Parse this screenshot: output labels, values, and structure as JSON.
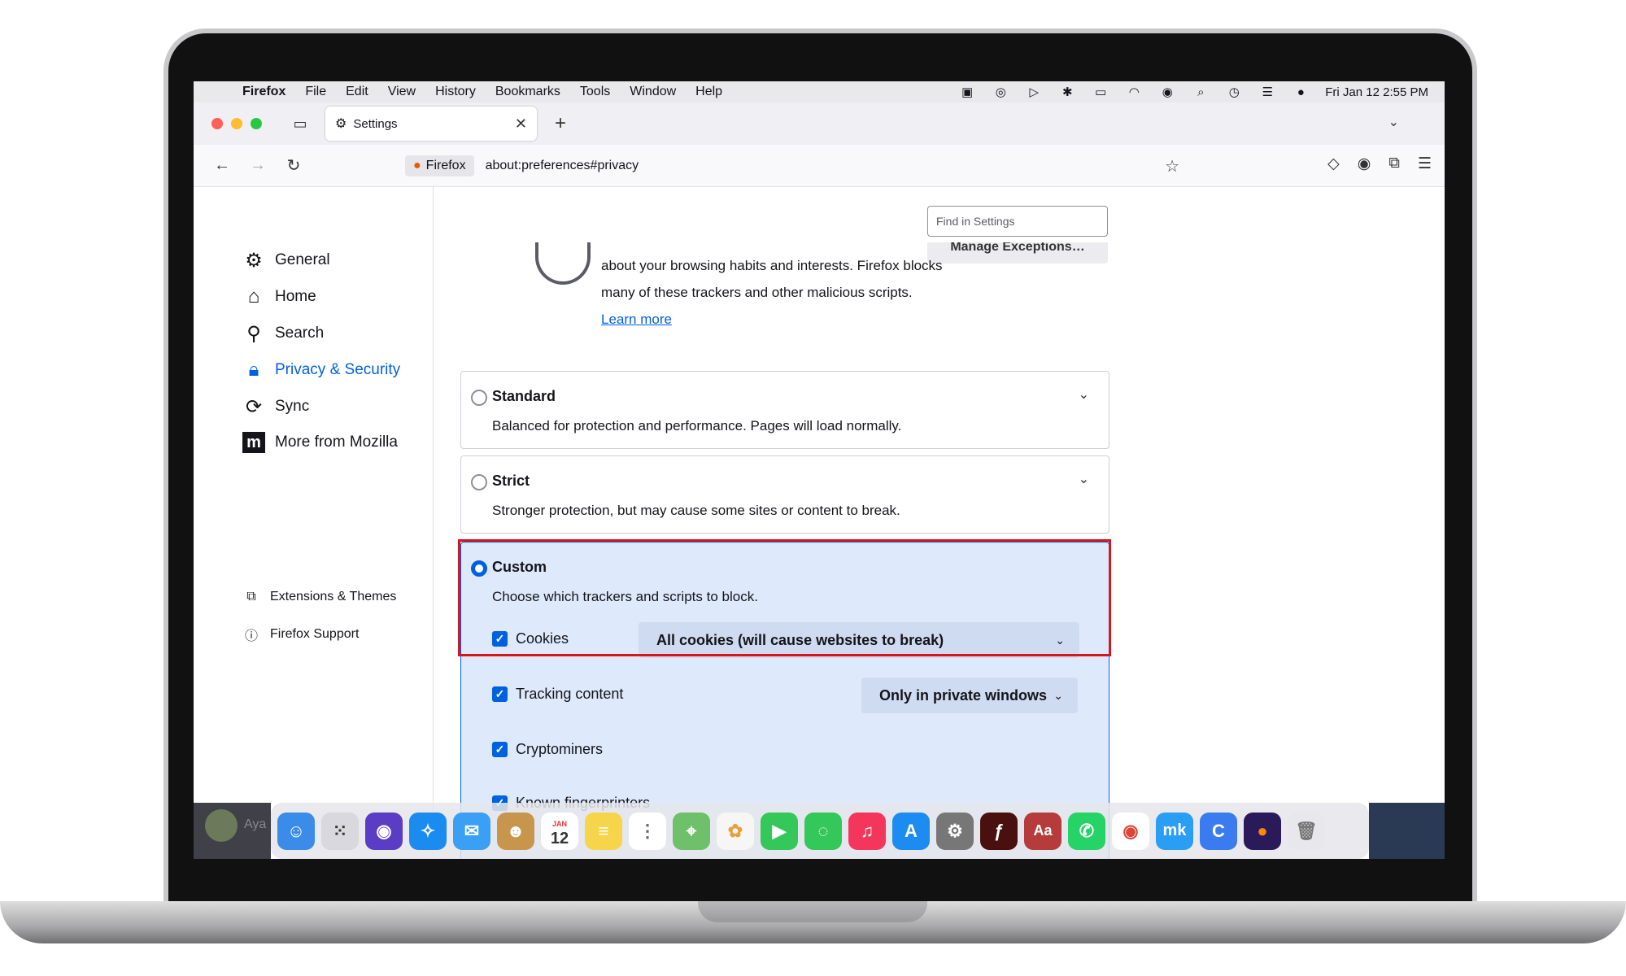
{
  "menubar": {
    "app": "Firefox",
    "items": [
      "File",
      "Edit",
      "View",
      "History",
      "Bookmarks",
      "Tools",
      "Window",
      "Help"
    ],
    "clock": "Fri Jan 12  2:55 PM"
  },
  "tabs": [
    {
      "label": "Settings",
      "active": true
    }
  ],
  "navbar": {
    "identity": "Firefox",
    "url": "about:preferences#privacy"
  },
  "sidebar": {
    "categories": [
      {
        "label": "General",
        "icon": "gear-icon"
      },
      {
        "label": "Home",
        "icon": "home-icon"
      },
      {
        "label": "Search",
        "icon": "search-icon"
      },
      {
        "label": "Privacy & Security",
        "icon": "lock-icon",
        "selected": true
      },
      {
        "label": "Sync",
        "icon": "sync-icon"
      },
      {
        "label": "More from Mozilla",
        "icon": "mozilla-icon"
      }
    ],
    "footer": [
      {
        "label": "Extensions & Themes",
        "icon": "puzzle-icon"
      },
      {
        "label": "Firefox Support",
        "icon": "help-icon"
      }
    ]
  },
  "main": {
    "search_placeholder": "Find in Settings",
    "manage_exceptions": "Manage Exceptions…",
    "intro_line1": "about your browsing habits and interests. Firefox blocks",
    "intro_line2": "many of these trackers and other malicious scripts.",
    "learn_more": "Learn more",
    "options": {
      "standard": {
        "title": "Standard",
        "desc": "Balanced for protection and performance. Pages will load normally."
      },
      "strict": {
        "title": "Strict",
        "desc": "Stronger protection, but may cause some sites or content to break."
      },
      "custom": {
        "title": "Custom",
        "desc": "Choose which trackers and scripts to block.",
        "selected": true
      }
    },
    "custom_items": {
      "cookies": {
        "label": "Cookies",
        "checked": true,
        "value": "All cookies (will cause websites to break)"
      },
      "tracking": {
        "label": "Tracking content",
        "checked": true,
        "value": "Only in private windows"
      },
      "cryptominers": {
        "label": "Cryptominers",
        "checked": true
      },
      "fingerprinters": {
        "label": "Known fingerprinters",
        "checked": true
      }
    }
  },
  "dock": {
    "calendar_month": "JAN",
    "calendar_day": "12",
    "user": "Aya",
    "apps": [
      "finder",
      "launchpad",
      "siri",
      "safari",
      "mail",
      "contacts",
      "calendar",
      "notes",
      "reminders",
      "maps",
      "photos",
      "facetime",
      "messages",
      "music",
      "app-store",
      "system-settings",
      "flash",
      "dictionary",
      "whatsapp",
      "chrome",
      "mk",
      "c-app",
      "firefox",
      "trash"
    ]
  },
  "colors": {
    "accent": "#0061e0",
    "highlight_border": "#d9141b",
    "custom_bg": "#deeafc"
  }
}
